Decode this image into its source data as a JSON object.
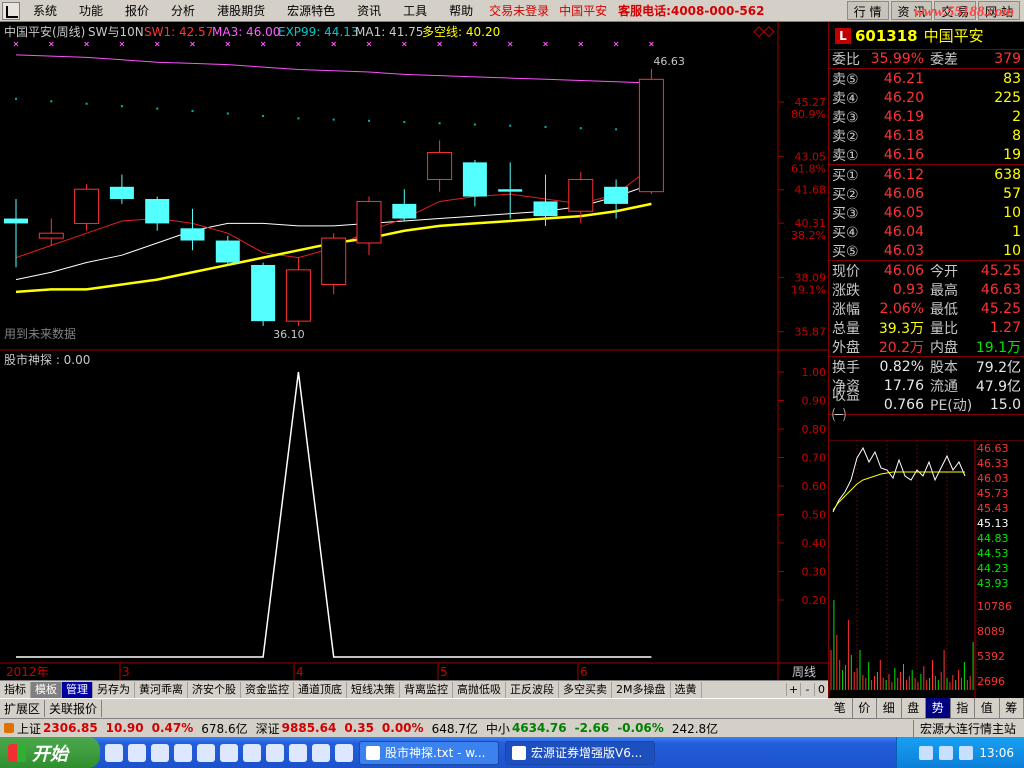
{
  "menubar": {
    "items": [
      "系统",
      "功能",
      "报价",
      "分析",
      "港股期货",
      "宏源特色",
      "资讯",
      "工具",
      "帮助"
    ],
    "status": "交易未登录",
    "stock": "中国平安",
    "phone": "客服电话:4008-000-562",
    "buttons": [
      "行 情",
      "资 讯",
      "交 易",
      "网 站"
    ],
    "watermark": "www.55188.com"
  },
  "chart": {
    "header_name": "中国平安(周线)",
    "header_formula": "SW与10N",
    "indicators": [
      {
        "label": "SW1: 42.57",
        "color": "#ff3232"
      },
      {
        "label": "MA3: 46.00",
        "color": "#ff60ff"
      },
      {
        "label": "EXP99: 44.13",
        "color": "#00c8c8"
      },
      {
        "label": "MA1: 41.75",
        "color": "#c8c8c8"
      },
      {
        "label": "多空线: 40.20",
        "color": "#ffff00"
      }
    ],
    "future_data_note": "用到未来数据",
    "sub_title": "股市神探 : 0.00",
    "period": "周线",
    "high_label": "46.63",
    "low_label": "36.10",
    "price_ticks": [
      {
        "value": "45.27",
        "pct": "80.9%"
      },
      {
        "value": "43.05",
        "pct": "61.8%"
      },
      {
        "value": "41.68",
        "pct": ""
      },
      {
        "value": "40.31",
        "pct": "38.2%"
      },
      {
        "value": "38.09",
        "pct": "19.1%"
      },
      {
        "value": "35.87",
        "pct": ""
      }
    ],
    "sub_ticks": [
      "1.00",
      "0.90",
      "0.80",
      "0.70",
      "0.60",
      "0.50",
      "0.40",
      "0.30",
      "0.20"
    ],
    "time_labels": [
      "2012年",
      "3",
      "4",
      "5",
      "6"
    ]
  },
  "chart_data": {
    "type": "candlestick",
    "title": "中国平安(周线)",
    "ylim": [
      35.87,
      47.0
    ],
    "candles": [
      {
        "open": 40.5,
        "close": 40.3,
        "high": 41.3,
        "low": 38.5
      },
      {
        "open": 39.7,
        "close": 39.9,
        "high": 40.5,
        "low": 39.4
      },
      {
        "open": 40.3,
        "close": 41.7,
        "high": 41.9,
        "low": 40.0
      },
      {
        "open": 41.8,
        "close": 41.3,
        "high": 42.3,
        "low": 41.1
      },
      {
        "open": 41.3,
        "close": 40.3,
        "high": 41.4,
        "low": 40.0
      },
      {
        "open": 40.1,
        "close": 39.6,
        "high": 40.9,
        "low": 39.2
      },
      {
        "open": 39.6,
        "close": 38.7,
        "high": 39.8,
        "low": 38.6
      },
      {
        "open": 38.6,
        "close": 36.3,
        "high": 38.7,
        "low": 36.1
      },
      {
        "open": 36.3,
        "close": 38.4,
        "high": 38.9,
        "low": 36.1
      },
      {
        "open": 37.8,
        "close": 39.7,
        "high": 39.9,
        "low": 37.4
      },
      {
        "open": 39.5,
        "close": 41.2,
        "high": 41.4,
        "low": 39.0
      },
      {
        "open": 41.1,
        "close": 40.5,
        "high": 41.7,
        "low": 40.4
      },
      {
        "open": 42.1,
        "close": 43.2,
        "high": 43.7,
        "low": 41.6
      },
      {
        "open": 42.8,
        "close": 41.4,
        "high": 42.9,
        "low": 41.0
      },
      {
        "open": 41.7,
        "close": 41.6,
        "high": 42.8,
        "low": 40.5
      },
      {
        "open": 41.2,
        "close": 40.6,
        "high": 42.3,
        "low": 40.2
      },
      {
        "open": 40.8,
        "close": 42.1,
        "high": 42.4,
        "low": 40.3
      },
      {
        "open": 41.8,
        "close": 41.1,
        "high": 42.1,
        "low": 40.5
      },
      {
        "open": 41.6,
        "close": 46.2,
        "high": 46.63,
        "low": 41.5
      }
    ],
    "ma_white": [
      38.0,
      38.3,
      38.7,
      39.0,
      39.5,
      40.0,
      40.3,
      40.3,
      40.2,
      40.2,
      40.3,
      40.4,
      40.5,
      40.6,
      40.7,
      40.8,
      41.0,
      41.4,
      41.9
    ],
    "sw1_red": [
      38.9,
      39.4,
      39.9,
      40.4,
      40.5,
      40.3,
      39.9,
      39.1,
      38.9,
      39.3,
      40.0,
      40.5,
      41.2,
      41.4,
      41.5,
      41.3,
      41.1,
      41.5,
      42.6
    ],
    "multi_yellow": [
      37.5,
      37.6,
      37.6,
      37.8,
      38.0,
      38.3,
      38.6,
      38.9,
      39.2,
      39.5,
      39.7,
      40.0,
      40.2,
      40.3,
      40.4,
      40.5,
      40.6,
      40.8,
      41.1
    ],
    "ma3_magenta": [
      47.2,
      47.15,
      47.1,
      47.0,
      46.9,
      46.85,
      46.8,
      46.7,
      46.6,
      46.55,
      46.5,
      46.4,
      46.35,
      46.3,
      46.25,
      46.2,
      46.15,
      46.1,
      46.05
    ],
    "exp_cyan_dots": [
      45.4,
      45.3,
      45.2,
      45.1,
      45.0,
      44.9,
      44.8,
      44.7,
      44.6,
      44.55,
      44.5,
      44.45,
      44.4,
      44.35,
      44.3,
      44.25,
      44.2,
      44.15,
      44.13
    ],
    "signal_marks": [
      1,
      1,
      1,
      1,
      1,
      1,
      1,
      1,
      1,
      1,
      1,
      1,
      1,
      1,
      1,
      1,
      1,
      1,
      1
    ],
    "sub_indicator": [
      0,
      0,
      0,
      0,
      0,
      0,
      0,
      0,
      1,
      0,
      0,
      0,
      0,
      0,
      0,
      0,
      0,
      0,
      0
    ],
    "sub_ylim": [
      0.0,
      1.0
    ]
  },
  "quote": {
    "code": "601318",
    "name": "中国平安",
    "wei_bi_label": "委比",
    "wei_bi": "35.99%",
    "wei_cha_label": "委差",
    "wei_cha": "379",
    "sells": [
      {
        "label": "卖⑤",
        "price": "46.21",
        "vol": "83"
      },
      {
        "label": "卖④",
        "price": "46.20",
        "vol": "225"
      },
      {
        "label": "卖③",
        "price": "46.19",
        "vol": "2"
      },
      {
        "label": "卖②",
        "price": "46.18",
        "vol": "8"
      },
      {
        "label": "卖①",
        "price": "46.16",
        "vol": "19"
      }
    ],
    "buys": [
      {
        "label": "买①",
        "price": "46.12",
        "vol": "638"
      },
      {
        "label": "买②",
        "price": "46.06",
        "vol": "57"
      },
      {
        "label": "买③",
        "price": "46.05",
        "vol": "10"
      },
      {
        "label": "买④",
        "price": "46.04",
        "vol": "1"
      },
      {
        "label": "买⑤",
        "price": "46.03",
        "vol": "10"
      }
    ],
    "stats": [
      {
        "l1": "现价",
        "v1": "46.06",
        "c1": "red",
        "l2": "今开",
        "v2": "45.25",
        "c2": "red"
      },
      {
        "l1": "涨跌",
        "v1": "0.93",
        "c1": "red",
        "l2": "最高",
        "v2": "46.63",
        "c2": "red"
      },
      {
        "l1": "涨幅",
        "v1": "2.06%",
        "c1": "red",
        "l2": "最低",
        "v2": "45.25",
        "c2": "red"
      },
      {
        "l1": "总量",
        "v1": "39.3万",
        "c1": "yellow",
        "l2": "量比",
        "v2": "1.27",
        "c2": "red"
      },
      {
        "l1": "外盘",
        "v1": "20.2万",
        "c1": "red",
        "l2": "内盘",
        "v2": "19.1万",
        "c2": "green"
      }
    ],
    "stats2": [
      {
        "l1": "换手",
        "v1": "0.82%",
        "l2": "股本",
        "v2": "79.2亿"
      },
      {
        "l1": "净资",
        "v1": "17.76",
        "l2": "流通",
        "v2": "47.9亿"
      },
      {
        "l1": "收益㈠",
        "v1": "0.766",
        "l2": "PE(动)",
        "v2": "15.0"
      }
    ],
    "mini_prices": [
      "46.63",
      "46.33",
      "46.03",
      "45.73",
      "45.43",
      "45.13",
      "44.83",
      "44.53",
      "44.23",
      "43.93"
    ],
    "mini_vols": [
      "10786",
      "8089",
      "5392",
      "2696"
    ]
  },
  "right_tabs": [
    "笔",
    "价",
    "细",
    "盘",
    "势",
    "指",
    "值",
    "筹"
  ],
  "right_tabs_active": "势",
  "tab_bar": {
    "items": [
      "指标",
      "模板",
      "管理",
      "另存为",
      "黄河乖离",
      "济安个股",
      "资金监控",
      "通道顶底",
      "短线决策",
      "背离监控",
      "高抛低吸",
      "正反波段",
      "多空买卖",
      "2M多操盘",
      "选黄"
    ],
    "zoom": [
      "+",
      "-",
      "0"
    ]
  },
  "ext_bar": [
    "扩展区",
    "关联报价"
  ],
  "index_bar": {
    "sh_name": "上证",
    "sh_value": "2306.85",
    "sh_change": "10.90",
    "sh_pct": "0.47%",
    "sh_amount": "678.6亿",
    "sz_name": "深证",
    "sz_value": "9885.64",
    "sz_change": "0.35",
    "sz_pct": "0.00%",
    "sz_amount": "648.7亿",
    "zx_name": "中小",
    "zx_value": "4634.76",
    "zx_change": "-2.66",
    "zx_pct": "-0.06%",
    "zx_amount": "242.8亿",
    "broker": "宏源大连行情主站"
  },
  "taskbar": {
    "start": "开始",
    "tasks": [
      "股市神探.txt - w...",
      "宏源证券增强版V6..."
    ],
    "clock": "13:06"
  }
}
